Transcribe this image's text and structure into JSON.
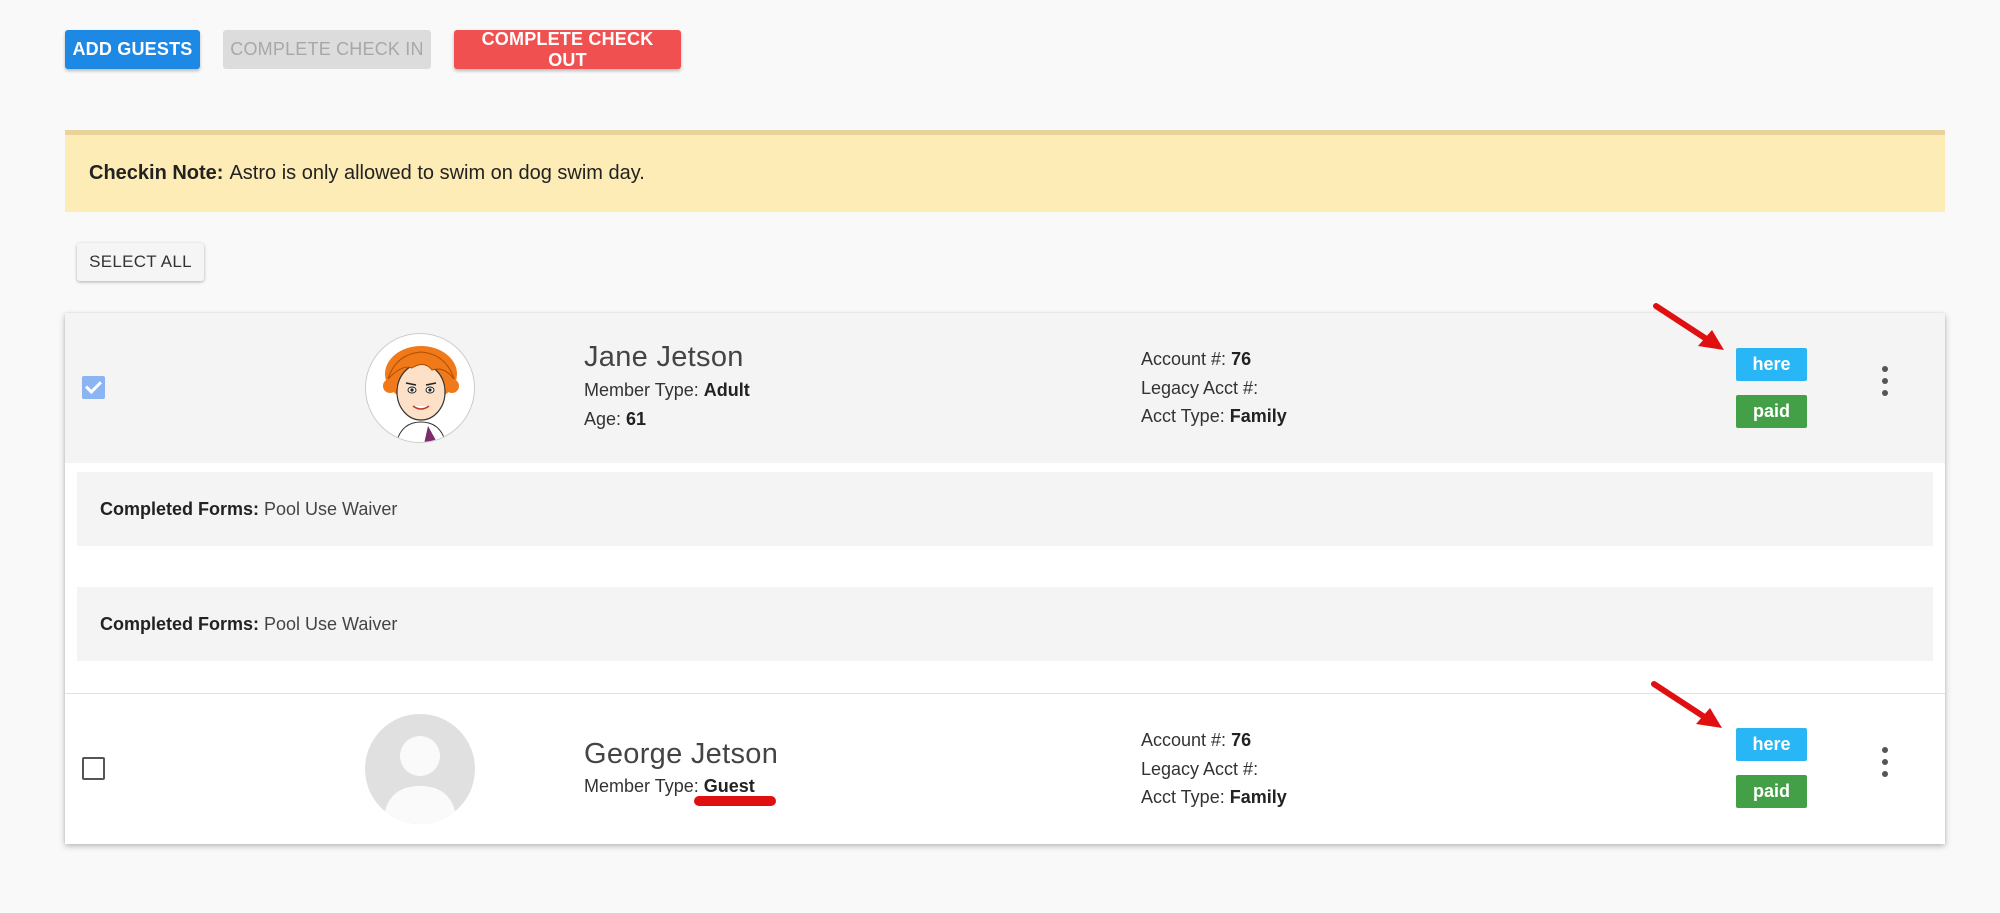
{
  "toolbar": {
    "add_guests": "ADD GUESTS",
    "complete_check_in": "COMPLETE CHECK IN",
    "complete_check_out": "COMPLETE CHECK OUT"
  },
  "note": {
    "label": "Checkin Note:",
    "text": "Astro is only allowed to swim on dog swim day."
  },
  "select_all": "SELECT ALL",
  "members": [
    {
      "name": "Jane Jetson",
      "member_type_label": "Member Type:",
      "member_type": "Adult",
      "age_label": "Age:",
      "age": "61",
      "account_label": "Account #:",
      "account": "76",
      "legacy_label": "Legacy Acct #:",
      "legacy": "",
      "acct_type_label": "Acct Type:",
      "acct_type": "Family",
      "status": "here",
      "payment": "paid",
      "checked": true
    },
    {
      "name": "George Jetson",
      "member_type_label": "Member Type:",
      "member_type": "Guest",
      "account_label": "Account #:",
      "account": "76",
      "legacy_label": "Legacy Acct #:",
      "legacy": "",
      "acct_type_label": "Acct Type:",
      "acct_type": "Family",
      "status": "here",
      "payment": "paid",
      "checked": false
    }
  ],
  "forms": [
    {
      "label": "Completed Forms:",
      "value": "Pool Use Waiver"
    },
    {
      "label": "Completed Forms:",
      "value": "Pool Use Waiver"
    }
  ],
  "colors": {
    "primary": "#1e88e5",
    "danger": "#f05050",
    "note_bg": "#fdecb5",
    "here": "#29b6f6",
    "paid": "#43a047",
    "annotation": "#e01010"
  }
}
